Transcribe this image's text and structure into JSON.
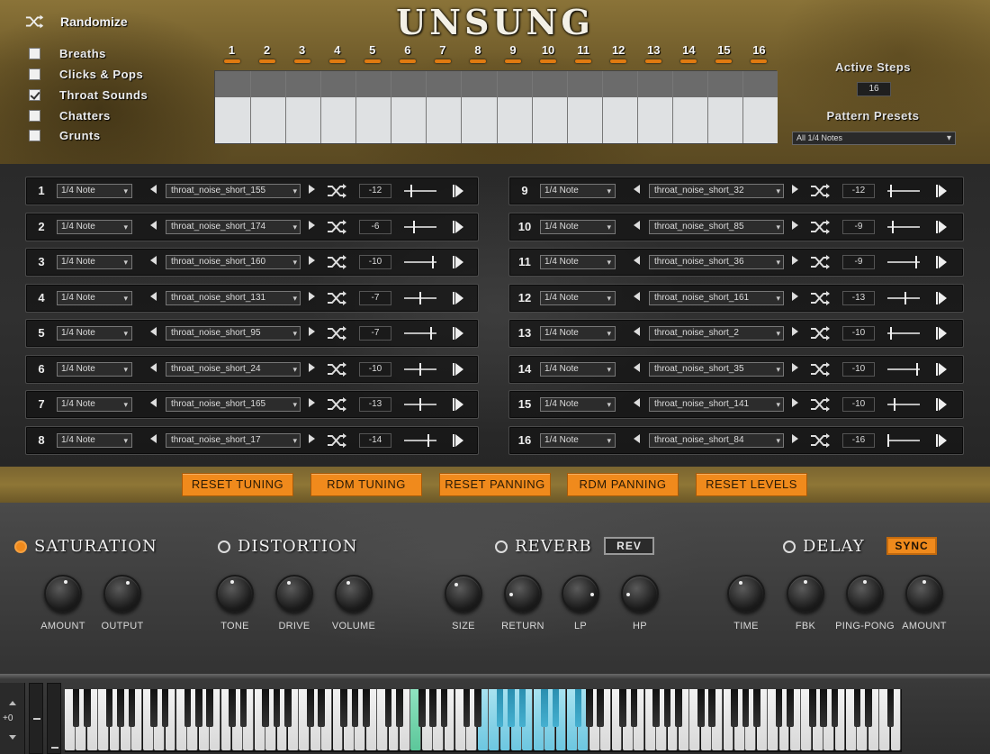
{
  "app": {
    "title": "UNSUNG",
    "accent": "#f08a1c"
  },
  "randomize": {
    "label": "Randomize",
    "icon": "shuffle-icon"
  },
  "categories": [
    {
      "label": "Breaths",
      "checked": false
    },
    {
      "label": "Clicks & Pops",
      "checked": false
    },
    {
      "label": "Throat Sounds",
      "checked": true
    },
    {
      "label": "Chatters",
      "checked": false
    },
    {
      "label": "Grunts",
      "checked": false
    }
  ],
  "steps": [
    "1",
    "2",
    "3",
    "4",
    "5",
    "6",
    "7",
    "8",
    "9",
    "10",
    "11",
    "12",
    "13",
    "14",
    "15",
    "16"
  ],
  "active_steps": {
    "label": "Active Steps",
    "value": "16"
  },
  "pattern_presets": {
    "label": "Pattern Presets",
    "value": "All 1/4 Notes"
  },
  "sequence_rows": [
    {
      "num": "1",
      "note": "1/4 Note",
      "sample": "throat_noise_short_155",
      "tune": "-12",
      "pan": 0.2
    },
    {
      "num": "2",
      "note": "1/4 Note",
      "sample": "throat_noise_short_174",
      "tune": "-6",
      "pan": 0.3
    },
    {
      "num": "3",
      "note": "1/4 Note",
      "sample": "throat_noise_short_160",
      "tune": "-10",
      "pan": 0.9
    },
    {
      "num": "4",
      "note": "1/4 Note",
      "sample": "throat_noise_short_131",
      "tune": "-7",
      "pan": 0.5
    },
    {
      "num": "5",
      "note": "1/4 Note",
      "sample": "throat_noise_short_95",
      "tune": "-7",
      "pan": 0.85
    },
    {
      "num": "6",
      "note": "1/4 Note",
      "sample": "throat_noise_short_24",
      "tune": "-10",
      "pan": 0.5
    },
    {
      "num": "7",
      "note": "1/4 Note",
      "sample": "throat_noise_short_165",
      "tune": "-13",
      "pan": 0.5
    },
    {
      "num": "8",
      "note": "1/4 Note",
      "sample": "throat_noise_short_17",
      "tune": "-14",
      "pan": 0.75
    },
    {
      "num": "9",
      "note": "1/4 Note",
      "sample": "throat_noise_short_32",
      "tune": "-12",
      "pan": 0.1
    },
    {
      "num": "10",
      "note": "1/4 Note",
      "sample": "throat_noise_short_85",
      "tune": "-9",
      "pan": 0.15
    },
    {
      "num": "11",
      "note": "1/4 Note",
      "sample": "throat_noise_short_36",
      "tune": "-9",
      "pan": 0.9
    },
    {
      "num": "12",
      "note": "1/4 Note",
      "sample": "throat_noise_short_161",
      "tune": "-13",
      "pan": 0.55
    },
    {
      "num": "13",
      "note": "1/4 Note",
      "sample": "throat_noise_short_2",
      "tune": "-10",
      "pan": 0.1
    },
    {
      "num": "14",
      "note": "1/4 Note",
      "sample": "throat_noise_short_35",
      "tune": "-10",
      "pan": 0.95
    },
    {
      "num": "15",
      "note": "1/4 Note",
      "sample": "throat_noise_short_141",
      "tune": "-10",
      "pan": 0.2
    },
    {
      "num": "16",
      "note": "1/4 Note",
      "sample": "throat_noise_short_84",
      "tune": "-16",
      "pan": 0.0
    }
  ],
  "buttons": [
    "RESET TUNING",
    "RDM TUNING",
    "RESET PANNING",
    "RDM PANNING",
    "RESET LEVELS"
  ],
  "fx": {
    "saturation": {
      "label": "SATURATION",
      "on": true,
      "knobs": [
        "AMOUNT",
        "OUTPUT"
      ]
    },
    "distortion": {
      "label": "DISTORTION",
      "on": false,
      "knobs": [
        "TONE",
        "DRIVE",
        "VOLUME"
      ]
    },
    "reverb": {
      "label": "REVERB",
      "on": false,
      "button": "REV",
      "knobs": [
        "SIZE",
        "RETURN",
        "LP",
        "HP"
      ]
    },
    "delay": {
      "label": "DELAY",
      "on": false,
      "button": "SYNC",
      "knobs": [
        "TIME",
        "FBK",
        "PING-PONG",
        "AMOUNT"
      ]
    }
  },
  "knob_values": {
    "AMOUNT": 0.55,
    "OUTPUT": 0.6,
    "TONE": 0.45,
    "DRIVE": 0.4,
    "VOLUME": 0.4,
    "SIZE": 0.35,
    "RETURN": 0.15,
    "LP": 0.85,
    "HP": 0.15,
    "TIME": 0.4,
    "FBK": 0.5,
    "PING-PONG": 0.5,
    "AMOUNT2": 0.5
  },
  "keyboard": {
    "octave": "+0",
    "highlight_green": 31,
    "highlight_blue_range": [
      37,
      46
    ],
    "white_key_count": 75
  }
}
